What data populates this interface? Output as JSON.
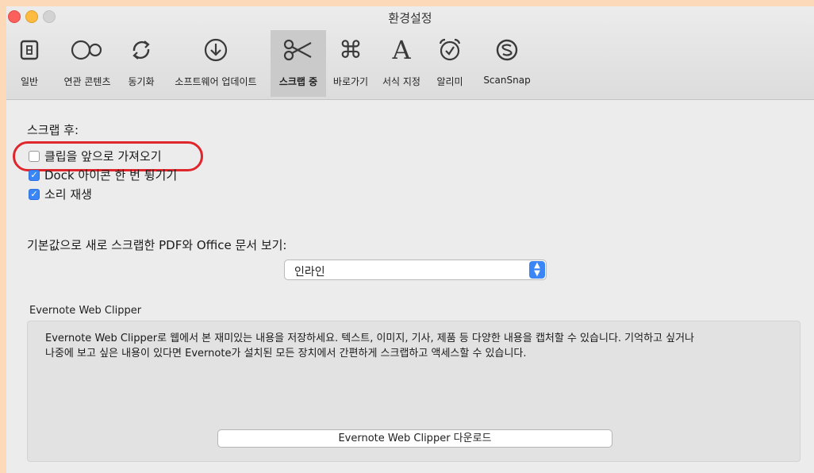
{
  "window": {
    "title": "환경설정"
  },
  "toolbar": {
    "items": [
      {
        "label": "일반",
        "icon": "general-icon"
      },
      {
        "label": "연관 콘텐츠",
        "icon": "related-content-icon"
      },
      {
        "label": "동기화",
        "icon": "sync-icon"
      },
      {
        "label": "소프트웨어 업데이트",
        "icon": "software-update-icon"
      },
      {
        "label": "스크랩 중",
        "icon": "scissors-icon",
        "active": true
      },
      {
        "label": "바로가기",
        "icon": "command-icon"
      },
      {
        "label": "서식 지정",
        "icon": "font-icon"
      },
      {
        "label": "알리미",
        "icon": "alarm-clock-icon"
      },
      {
        "label": "ScanSnap",
        "icon": "scansnap-icon"
      }
    ]
  },
  "after_clip": {
    "heading": "스크랩 후:",
    "options": [
      {
        "label": "클립을 앞으로 가져오기",
        "checked": false
      },
      {
        "label": "Dock 아이콘 한 번 튕기기",
        "checked": true
      },
      {
        "label": "소리 재생",
        "checked": true
      }
    ]
  },
  "default_view": {
    "label": "기본값으로 새로 스크랩한 PDF와 Office 문서 보기:",
    "selected": "인라인"
  },
  "web_clipper": {
    "title": "Evernote Web Clipper",
    "description_line1": "Evernote Web Clipper로 웹에서 본 재미있는 내용을 저장하세요. 텍스트, 이미지, 기사, 제품 등 다양한 내용을 캡처할 수 있습니다. 기억하고 싶거나",
    "description_line2": "나중에 보고 싶은 내용이 있다면 Evernote가 설치된 모든 장치에서 간편하게 스크랩하고 액세스할 수 있습니다.",
    "button_label": "Evernote Web Clipper 다운로드"
  },
  "colors": {
    "accent": "#3b86f7",
    "highlight_ring": "#e0262d",
    "page_background": "#fcd9b8"
  }
}
